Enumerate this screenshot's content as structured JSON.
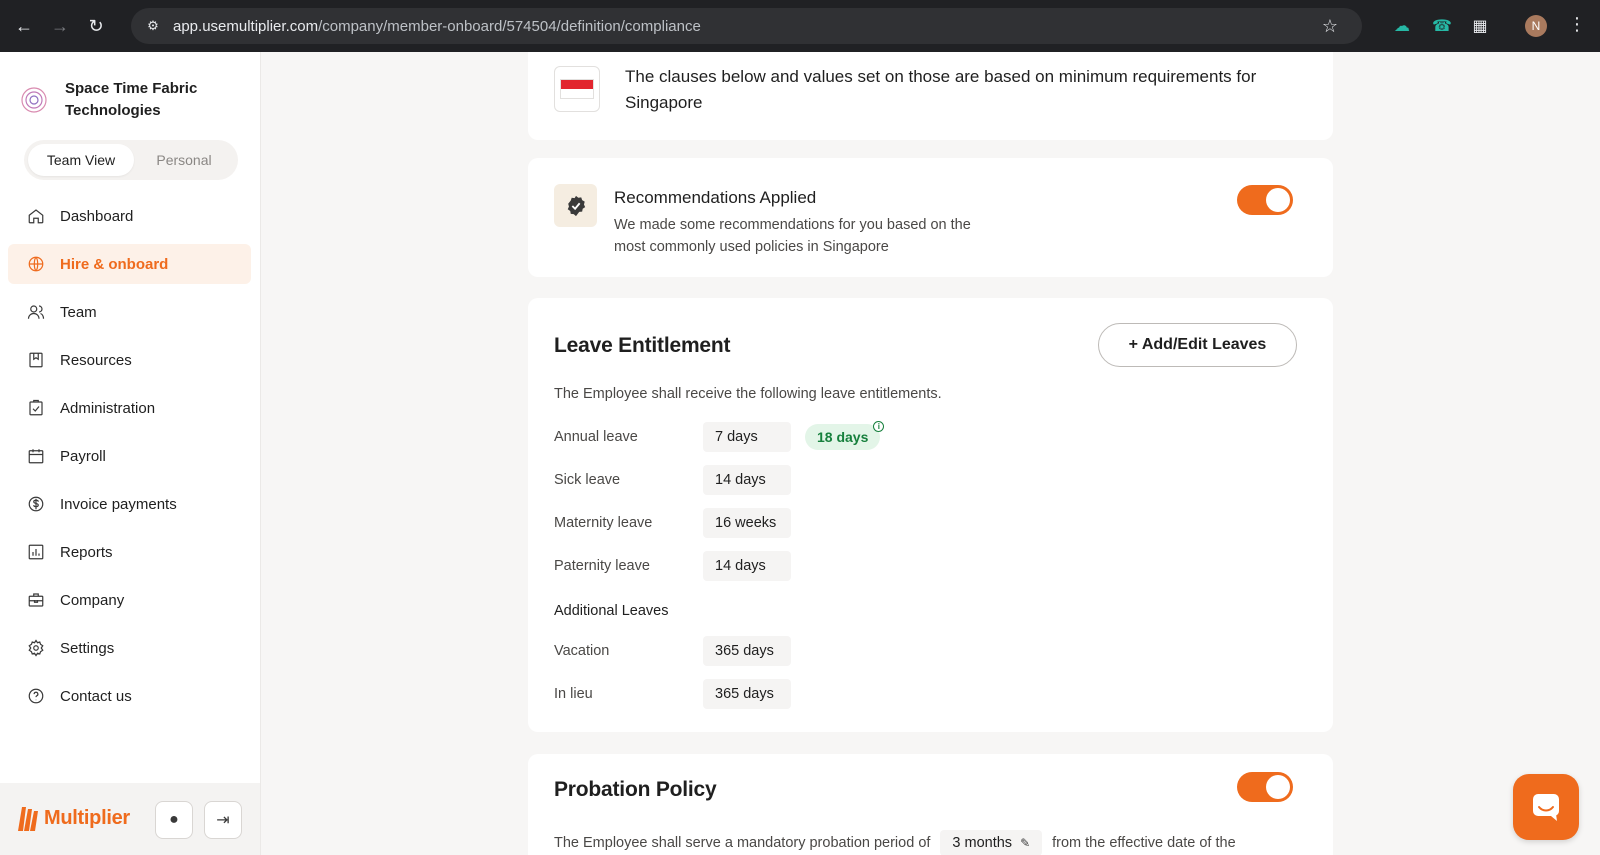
{
  "browser": {
    "url_host": "app.usemultiplier.com",
    "url_path": "/company/member-onboard/574504/definition/compliance",
    "profile_initial": "N"
  },
  "sidebar": {
    "company_name": "Space Time Fabric Technologies",
    "views": {
      "active": "Team View",
      "inactive": "Personal"
    },
    "items": [
      {
        "label": "Dashboard",
        "icon": "home-icon",
        "active": false
      },
      {
        "label": "Hire & onboard",
        "icon": "globe-icon",
        "active": true
      },
      {
        "label": "Team",
        "icon": "users-icon",
        "active": false
      },
      {
        "label": "Resources",
        "icon": "resources-icon",
        "active": false
      },
      {
        "label": "Administration",
        "icon": "clipboard-check-icon",
        "active": false
      },
      {
        "label": "Payroll",
        "icon": "calendar-icon",
        "active": false
      },
      {
        "label": "Invoice payments",
        "icon": "dollar-icon",
        "active": false
      },
      {
        "label": "Reports",
        "icon": "bar-chart-icon",
        "active": false
      },
      {
        "label": "Company",
        "icon": "briefcase-icon",
        "active": false
      },
      {
        "label": "Settings",
        "icon": "gear-icon",
        "active": false
      },
      {
        "label": "Contact us",
        "icon": "help-icon",
        "active": false
      }
    ],
    "footer": {
      "logo_text": "Multiplier"
    }
  },
  "main": {
    "country_notice": "The clauses below and values set on those are based on minimum requirements for Singapore",
    "recommendations": {
      "title": "Recommendations Applied",
      "description": "We made some recommendations for you based on the most commonly used policies in Singapore",
      "enabled": true
    },
    "leave": {
      "title": "Leave Entitlement",
      "add_edit_label": "+ Add/Edit Leaves",
      "intro": "The Employee shall receive the following leave entitlements.",
      "rows": [
        {
          "label": "Annual leave",
          "value": "7 days",
          "recommended": "18 days"
        },
        {
          "label": "Sick leave",
          "value": "14 days"
        },
        {
          "label": "Maternity leave",
          "value": "16 weeks"
        },
        {
          "label": "Paternity leave",
          "value": "14 days"
        }
      ],
      "additional_title": "Additional Leaves",
      "additional_rows": [
        {
          "label": "Vacation",
          "value": "365 days"
        },
        {
          "label": "In lieu",
          "value": "365 days"
        }
      ]
    },
    "probation": {
      "title": "Probation Policy",
      "enabled": true,
      "text_before": "The Employee shall serve a mandatory probation period of",
      "period": "3 months",
      "text_after": "from the effective date of the"
    }
  },
  "colors": {
    "accent": "#ef6b1d",
    "success": "#17803d",
    "chrome": "#202124"
  }
}
